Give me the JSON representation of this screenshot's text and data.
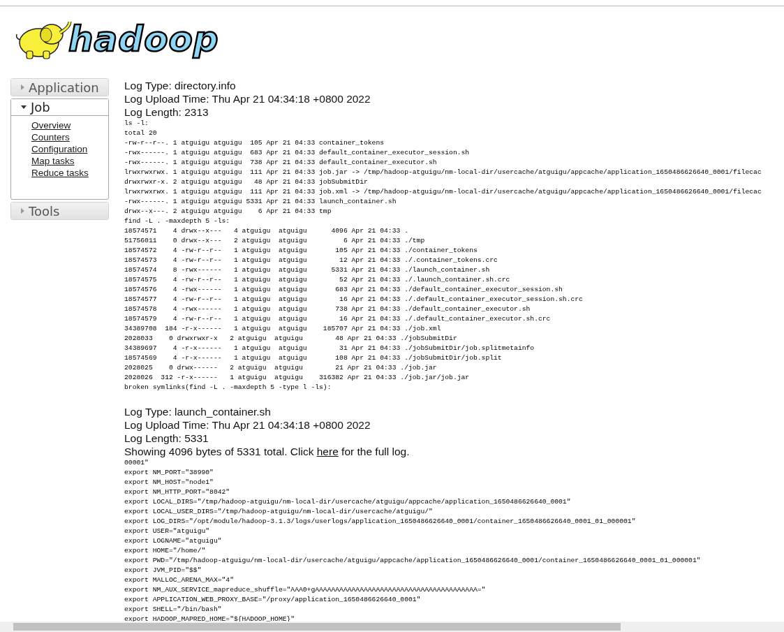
{
  "logo": {
    "text": "hadoop"
  },
  "sidebar": {
    "sections": [
      {
        "label": "Application",
        "expanded": false
      },
      {
        "label": "Job",
        "expanded": true,
        "links": [
          "Overview",
          "Counters",
          "Configuration",
          "Map tasks",
          "Reduce tasks"
        ]
      },
      {
        "label": "Tools",
        "expanded": false
      }
    ]
  },
  "logs": [
    {
      "type": "Log Type: directory.info",
      "upload_time": "Log Upload Time: Thu Apr 21 04:34:18 +0800 2022",
      "length": "Log Length: 2313",
      "lines": [
        "ls -l:",
        "total 20",
        "-rw-r--r--. 1 atguigu atguigu  105 Apr 21 04:33 container_tokens",
        "-rwx------. 1 atguigu atguigu  683 Apr 21 04:33 default_container_executor_session.sh",
        "-rwx------. 1 atguigu atguigu  738 Apr 21 04:33 default_container_executor.sh",
        "lrwxrwxrwx. 1 atguigu atguigu  111 Apr 21 04:33 job.jar -> /tmp/hadoop-atguigu/nm-local-dir/usercache/atguigu/appcache/application_1650486626640_0001/filecac",
        "drwxrwxr-x. 2 atguigu atguigu   48 Apr 21 04:33 jobSubmitDir",
        "lrwxrwxrwx. 1 atguigu atguigu  111 Apr 21 04:33 job.xml -> /tmp/hadoop-atguigu/nm-local-dir/usercache/atguigu/appcache/application_1650486626640_0001/filecac",
        "-rwx------. 1 atguigu atguigu 5331 Apr 21 04:33 launch_container.sh",
        "drwx--x---. 2 atguigu atguigu    6 Apr 21 04:33 tmp",
        "find -L . -maxdepth 5 -ls:",
        "18574571    4 drwx--x---   4 atguigu  atguigu      4096 Apr 21 04:33 .",
        "51756011    0 drwx--x---   2 atguigu  atguigu         6 Apr 21 04:33 ./tmp",
        "18574572    4 -rw-r--r--   1 atguigu  atguigu       105 Apr 21 04:33 ./container_tokens",
        "18574573    4 -rw-r--r--   1 atguigu  atguigu        12 Apr 21 04:33 ./.container_tokens.crc",
        "18574574    8 -rwx------   1 atguigu  atguigu      5331 Apr 21 04:33 ./launch_container.sh",
        "18574575    4 -rw-r--r--   1 atguigu  atguigu        52 Apr 21 04:33 ./.launch_container.sh.crc",
        "18574576    4 -rwx------   1 atguigu  atguigu       683 Apr 21 04:33 ./default_container_executor_session.sh",
        "18574577    4 -rw-r--r--   1 atguigu  atguigu        16 Apr 21 04:33 ./.default_container_executor_session.sh.crc",
        "18574578    4 -rwx------   1 atguigu  atguigu       738 Apr 21 04:33 ./default_container_executor.sh",
        "18574579    4 -rw-r--r--   1 atguigu  atguigu        16 Apr 21 04:33 ./.default_container_executor.sh.crc",
        "34389708  184 -r-x------   1 atguigu  atguigu    185707 Apr 21 04:33 ./job.xml",
        "2028033    0 drwxrwxr-x   2 atguigu  atguigu        48 Apr 21 04:33 ./jobSubmitDir",
        "34389697    4 -r-x------   1 atguigu  atguigu        31 Apr 21 04:33 ./jobSubmitDir/job.splitmetainfo",
        "18574569    4 -r-x------   1 atguigu  atguigu       108 Apr 21 04:33 ./jobSubmitDir/job.split",
        "2028025    0 drwx------   2 atguigu  atguigu        21 Apr 21 04:33 ./job.jar",
        "2028026  312 -r-x------   1 atguigu  atguigu    316382 Apr 21 04:33 ./job.jar/job.jar",
        "broken symlinks(find -L . -maxdepth 5 -type l -ls):"
      ]
    },
    {
      "type": "Log Type: launch_container.sh",
      "upload_time": "Log Upload Time: Thu Apr 21 04:34:18 +0800 2022",
      "length": "Log Length: 5331",
      "notice": {
        "before": "Showing 4096 bytes of 5331 total. Click ",
        "link": "here",
        "after": " for the full log."
      },
      "lines": [
        "00001\"",
        "export NM_PORT=\"38990\"",
        "export NM_HOST=\"node1\"",
        "export NM_HTTP_PORT=\"8042\"",
        "export LOCAL_DIRS=\"/tmp/hadoop-atguigu/nm-local-dir/usercache/atguigu/appcache/application_1650486626640_0001\"",
        "export LOCAL_USER_DIRS=\"/tmp/hadoop-atguigu/nm-local-dir/usercache/atguigu/\"",
        "export LOG_DIRS=\"/opt/module/hadoop-3.1.3/logs/userlogs/application_1650486626640_0001/container_1650486626640_0001_01_000001\"",
        "export USER=\"atguigu\"",
        "export LOGNAME=\"atguigu\"",
        "export HOME=\"/home/\"",
        "export PWD=\"/tmp/hadoop-atguigu/nm-local-dir/usercache/atguigu/appcache/application_1650486626640_0001/container_1650486626640_0001_01_000001\"",
        "export JVM_PID=\"$$\"",
        "export MALLOC_ARENA_MAX=\"4\"",
        "export NM_AUX_SERVICE_mapreduce_shuffle=\"AAA0+gAAAAAAAAAAAAAAAAAAAAAAAAAAAAAAAAAAAAAAAA=\"",
        "export APPLICATION_WEB_PROXY_BASE=\"/proxy/application_1650486626640_0001\"",
        "export SHELL=\"/bin/bash\"",
        "export HADOOP_MAPRED_HOME=\"${HADOOP_HOME}\""
      ]
    }
  ]
}
